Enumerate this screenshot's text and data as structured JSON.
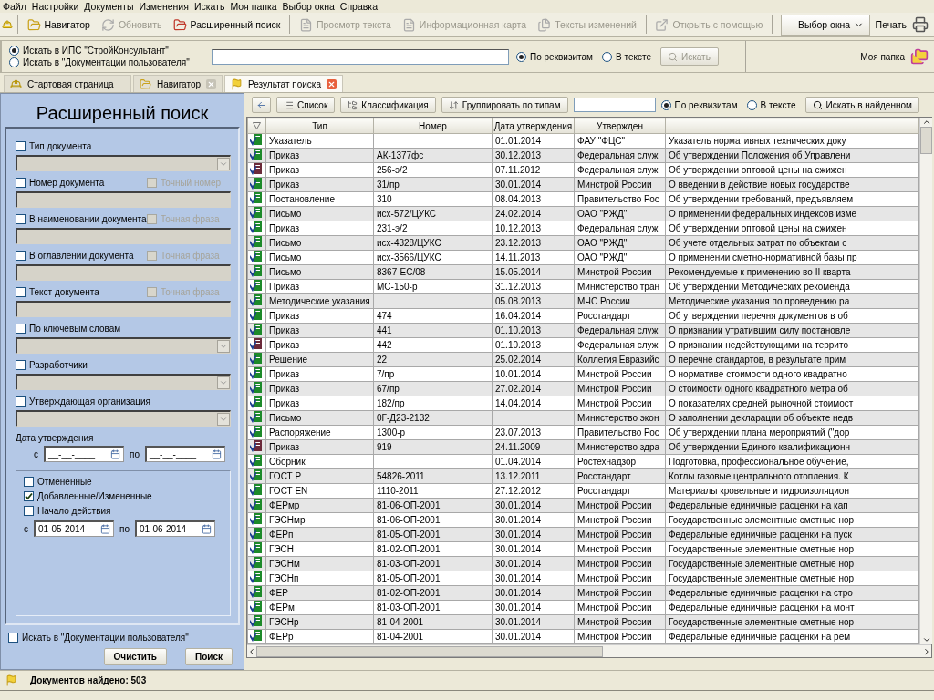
{
  "menu": [
    "Файл",
    "Настройки",
    "Документы",
    "Изменения",
    "Искать",
    "Моя папка",
    "Выбор окна",
    "Справка"
  ],
  "toolbar": {
    "items": [
      {
        "label": "Навигатор",
        "disabled": false,
        "separator_before": true
      },
      {
        "label": "Обновить",
        "disabled": true,
        "separator_before": false
      },
      {
        "label": "Расширенный поиск",
        "disabled": false,
        "separator_before": false
      },
      {
        "label": "Просмотр текста",
        "disabled": true,
        "separator_before": true
      },
      {
        "label": "Информационная карта",
        "disabled": true,
        "separator_before": false
      },
      {
        "label": "Тексты изменений",
        "disabled": true,
        "separator_before": false
      },
      {
        "label": "Открыть с помощью",
        "disabled": true,
        "separator_before": true
      }
    ],
    "window_select": "Выбор окна",
    "print": "Печать"
  },
  "quick_search": {
    "scopes": [
      {
        "label": "Искать в ИПС \"СтройКонсультант\"",
        "selected": true
      },
      {
        "label": "Искать в \"Документации пользователя\"",
        "selected": false
      }
    ],
    "modes": [
      {
        "label": "По реквизитам",
        "selected": true
      },
      {
        "label": "В тексте",
        "selected": false
      }
    ],
    "button": {
      "label": "Искать",
      "disabled": true
    },
    "my_folder": "Моя папка"
  },
  "tabs": [
    {
      "label": "Стартовая страница",
      "selected": false,
      "closable": false
    },
    {
      "label": "Навигатор",
      "selected": false,
      "closable": true
    },
    {
      "label": "Результат поиска",
      "selected": true,
      "closable": true
    }
  ],
  "search_panel": {
    "title": "Расширенный поиск",
    "fields": [
      {
        "kind": "select",
        "label": "Тип документа",
        "checked": false
      },
      {
        "kind": "text",
        "label": "Номер документа",
        "checked": false,
        "option": {
          "label": "Точный номер",
          "checked": false,
          "disabled": true
        }
      },
      {
        "kind": "text",
        "label": "В наименовании документа",
        "checked": false,
        "option": {
          "label": "Точная фраза",
          "checked": false,
          "disabled": true
        }
      },
      {
        "kind": "text",
        "label": "В оглавлении документа",
        "checked": false,
        "option": {
          "label": "Точная фраза",
          "checked": false,
          "disabled": true
        }
      },
      {
        "kind": "text",
        "label": "Текст документа",
        "checked": false,
        "option": {
          "label": "Точная фраза",
          "checked": false,
          "disabled": true
        }
      },
      {
        "kind": "select",
        "label": "По ключевым словам",
        "checked": false
      },
      {
        "kind": "select",
        "label": "Разработчики",
        "checked": false
      },
      {
        "kind": "select",
        "label": "Утверждающая организация",
        "checked": false
      }
    ],
    "date": {
      "label": "Дата утверждения",
      "from_label": "с",
      "from_value": "__-__-____",
      "to_label": "по",
      "to_value": "__-__-____"
    },
    "filters": [
      {
        "label": "Отмененные",
        "checked": false
      },
      {
        "label": "Добавленные/Измененные",
        "checked": true
      },
      {
        "label": "Начало действия",
        "checked": false
      }
    ],
    "range": {
      "from_label": "с",
      "from_value": "01-05-2014",
      "to_label": "по",
      "to_value": "01-06-2014"
    },
    "user_docs": {
      "label": "Искать в \"Документации пользователя\"",
      "checked": false
    },
    "buttons": [
      "Очистить",
      "Поиск"
    ]
  },
  "results_toolbar": {
    "buttons": [
      "Список",
      "Классификация",
      "Группировать по типам"
    ],
    "modes": [
      {
        "label": "По реквизитам",
        "selected": true
      },
      {
        "label": "В тексте",
        "selected": false
      }
    ],
    "search_button": "Искать в найденном"
  },
  "table": {
    "columns": [
      "Тип",
      "Номер",
      "Дата утверждения",
      "Утвержден"
    ],
    "rows": [
      {
        "valid": true,
        "type": "Указатель",
        "date": "01.01.2014",
        "approved_by": "ФАУ \"ФЦС\"",
        "column_5": "Указатель нормативных технических доку"
      },
      {
        "valid": true,
        "type": "Приказ",
        "number": "АК-1377фс",
        "date": "30.12.2013",
        "approved_by": "Федеральная служ",
        "column_5": "Об утверждении Положения об Управлени"
      },
      {
        "valid": false,
        "type": "Приказ",
        "number": "256-э/2",
        "date": "07.11.2012",
        "approved_by": "Федеральная служ",
        "column_5": "Об утверждении оптовой цены на сжижен"
      },
      {
        "valid": true,
        "type": "Приказ",
        "number": "31/пр",
        "date": "30.01.2014",
        "approved_by": "Минстрой России",
        "column_5": "О введении в действие новых государстве"
      },
      {
        "valid": true,
        "type": "Постановление",
        "number": "310",
        "date": "08.04.2013",
        "approved_by": "Правительство Рос",
        "column_5": "Об утверждении требований, предъявляем"
      },
      {
        "valid": true,
        "type": "Письмо",
        "number": "исх-572/ЦУКС",
        "date": "24.02.2014",
        "approved_by": "ОАО \"РЖД\"",
        "column_5": "О применении федеральных индексов изме"
      },
      {
        "valid": true,
        "type": "Приказ",
        "number": "231-э/2",
        "date": "10.12.2013",
        "approved_by": "Федеральная служ",
        "column_5": "Об утверждении оптовой цены на сжижен"
      },
      {
        "valid": true,
        "type": "Письмо",
        "number": "исх-4328/ЦУКС",
        "date": "23.12.2013",
        "approved_by": "ОАО \"РЖД\"",
        "column_5": "Об учете отдельных затрат по объектам с"
      },
      {
        "valid": true,
        "type": "Письмо",
        "number": "исх-3566/ЦУКС",
        "date": "14.11.2013",
        "approved_by": "ОАО \"РЖД\"",
        "column_5": "О применении сметно-нормативной базы пр"
      },
      {
        "valid": true,
        "type": "Письмо",
        "number": "8367-ЕС/08",
        "date": "15.05.2014",
        "approved_by": "Минстрой России",
        "column_5": "Рекомендуемые к применению во II кварта"
      },
      {
        "valid": true,
        "type": "Приказ",
        "number": "МС-150-р",
        "date": "31.12.2013",
        "approved_by": "Министерство тран",
        "column_5": "Об утверждении Методических рекоменда"
      },
      {
        "valid": true,
        "type": "Методические указания",
        "date": "05.08.2013",
        "approved_by": "МЧС России",
        "column_5": "Методические указания по проведению ра"
      },
      {
        "valid": true,
        "type": "Приказ",
        "number": "474",
        "date": "16.04.2014",
        "approved_by": "Росстандарт",
        "column_5": "Об утверждении перечня документов в об"
      },
      {
        "valid": true,
        "type": "Приказ",
        "number": "441",
        "date": "01.10.2013",
        "approved_by": "Федеральная служ",
        "column_5": "О признании утратившим силу постановле"
      },
      {
        "valid": false,
        "type": "Приказ",
        "number": "442",
        "date": "01.10.2013",
        "approved_by": "Федеральная служ",
        "column_5": "О признании недействующими на террито"
      },
      {
        "valid": true,
        "type": "Решение",
        "number": "22",
        "date": "25.02.2014",
        "approved_by": "Коллегия Евразийс",
        "column_5": "О перечне стандартов, в результате прим"
      },
      {
        "valid": true,
        "type": "Приказ",
        "number": "7/пр",
        "date": "10.01.2014",
        "approved_by": "Минстрой России",
        "column_5": "О нормативе стоимости одного квадратно"
      },
      {
        "valid": true,
        "type": "Приказ",
        "number": "67/пр",
        "date": "27.02.2014",
        "approved_by": "Минстрой России",
        "column_5": "О стоимости одного квадратного метра об"
      },
      {
        "valid": true,
        "type": "Приказ",
        "number": "182/пр",
        "date": "14.04.2014",
        "approved_by": "Минстрой России",
        "column_5": "О показателях средней рыночной стоимост"
      },
      {
        "valid": true,
        "type": "Письмо",
        "number": "0Г-Д23-2132",
        "approved_by": "Министерство экон",
        "column_5": "О заполнении декларации об объекте недв"
      },
      {
        "valid": true,
        "type": "Распоряжение",
        "number": "1300-р",
        "date": "23.07.2013",
        "approved_by": "Правительство Рос",
        "column_5": "Об утверждении плана мероприятий (\"дор"
      },
      {
        "valid": false,
        "type": "Приказ",
        "number": "919",
        "date": "24.11.2009",
        "approved_by": "Министерство здра",
        "column_5": "Об утверждении Единого квалификационн"
      },
      {
        "valid": true,
        "type": "Сборник",
        "date": "01.04.2014",
        "approved_by": "Ростехнадзор",
        "column_5": "Подготовка, профессиональное обучение,"
      },
      {
        "valid": true,
        "type": "ГОСТ Р",
        "number": "54826-2011",
        "date": "13.12.2011",
        "approved_by": "Росстандарт",
        "column_5": "Котлы газовые центрального отопления. К"
      },
      {
        "valid": true,
        "type": "ГОСТ EN",
        "number": "1110-2011",
        "date": "27.12.2012",
        "approved_by": "Росстандарт",
        "column_5": "Материалы кровельные и гидроизоляцион"
      },
      {
        "valid": true,
        "type": "ФЕРмр",
        "number": "81-06-ОП-2001",
        "date": "30.01.2014",
        "approved_by": "Минстрой России",
        "column_5": "Федеральные единичные расценки на кап"
      },
      {
        "valid": true,
        "type": "ГЭСНмр",
        "number": "81-06-ОП-2001",
        "date": "30.01.2014",
        "approved_by": "Минстрой России",
        "column_5": "Государственные элементные сметные нор"
      },
      {
        "valid": true,
        "type": "ФЕРп",
        "number": "81-05-ОП-2001",
        "date": "30.01.2014",
        "approved_by": "Минстрой России",
        "column_5": "Федеральные единичные расценки на пуск"
      },
      {
        "valid": true,
        "type": "ГЭСН",
        "number": "81-02-ОП-2001",
        "date": "30.01.2014",
        "approved_by": "Минстрой России",
        "column_5": "Государственные элементные сметные нор"
      },
      {
        "valid": true,
        "type": "ГЭСНм",
        "number": "81-03-ОП-2001",
        "date": "30.01.2014",
        "approved_by": "Минстрой России",
        "column_5": "Государственные элементные сметные нор"
      },
      {
        "valid": true,
        "type": "ГЭСНп",
        "number": "81-05-ОП-2001",
        "date": "30.01.2014",
        "approved_by": "Минстрой России",
        "column_5": "Государственные элементные сметные нор"
      },
      {
        "valid": true,
        "type": "ФЕР",
        "number": "81-02-ОП-2001",
        "date": "30.01.2014",
        "approved_by": "Минстрой России",
        "column_5": "Федеральные единичные расценки на стро"
      },
      {
        "valid": true,
        "type": "ФЕРм",
        "number": "81-03-ОП-2001",
        "date": "30.01.2014",
        "approved_by": "Минстрой России",
        "column_5": "Федеральные единичные расценки на монт"
      },
      {
        "valid": true,
        "type": "ГЭСНр",
        "number": "81-04-2001",
        "date": "30.01.2014",
        "approved_by": "Минстрой России",
        "column_5": "Государственные элементные сметные нор"
      },
      {
        "valid": true,
        "type": "ФЕРр",
        "number": "81-04-2001",
        "date": "30.01.2014",
        "approved_by": "Минстрой России",
        "column_5": "Федеральные единичные расценки на рем"
      }
    ]
  },
  "status_bar": "Документов найдено: 503"
}
